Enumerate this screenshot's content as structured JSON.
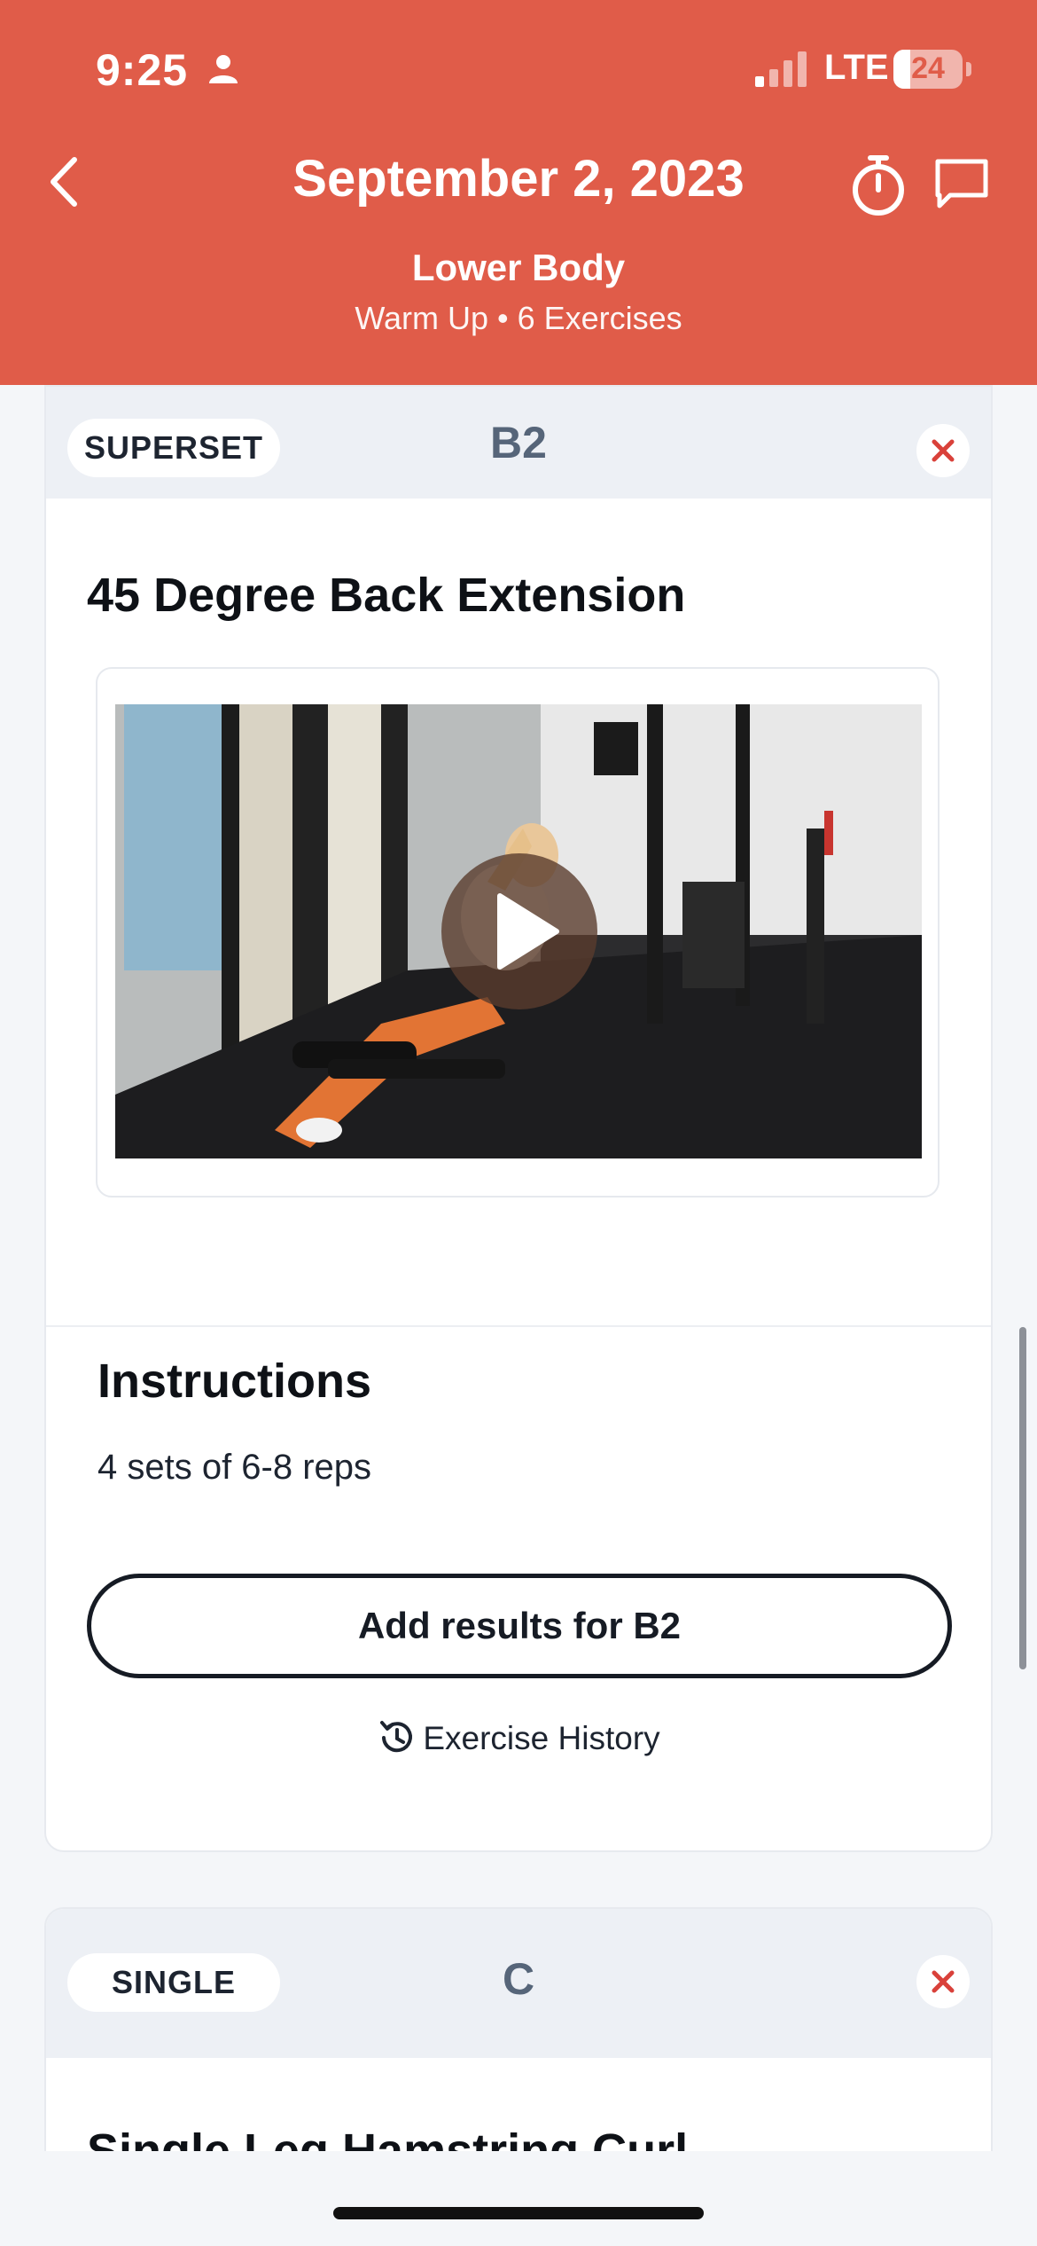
{
  "status_bar": {
    "time": "9:25",
    "network": "LTE",
    "battery": "24",
    "battery_level": 0.24
  },
  "header": {
    "date": "September 2, 2023",
    "workout_name": "Lower Body",
    "meta": "Warm Up • 6 Exercises",
    "accent_color": "#e05c49"
  },
  "card1": {
    "tag": "SUPERSET",
    "code": "B2",
    "title": "45 Degree Back Extension",
    "instructions_heading": "Instructions",
    "instructions_text": "4 sets of 6-8 reps",
    "add_results_label": "Add results for B2",
    "history_label": "Exercise History"
  },
  "card2": {
    "tag": "SINGLE",
    "code": "C",
    "title": "Single Leg Hamstring Curl"
  },
  "icons": {
    "back": "chevron-left-icon",
    "timer": "stopwatch-icon",
    "chat": "chat-bubble-icon",
    "remove": "close-icon",
    "play": "play-icon",
    "history": "history-icon"
  }
}
